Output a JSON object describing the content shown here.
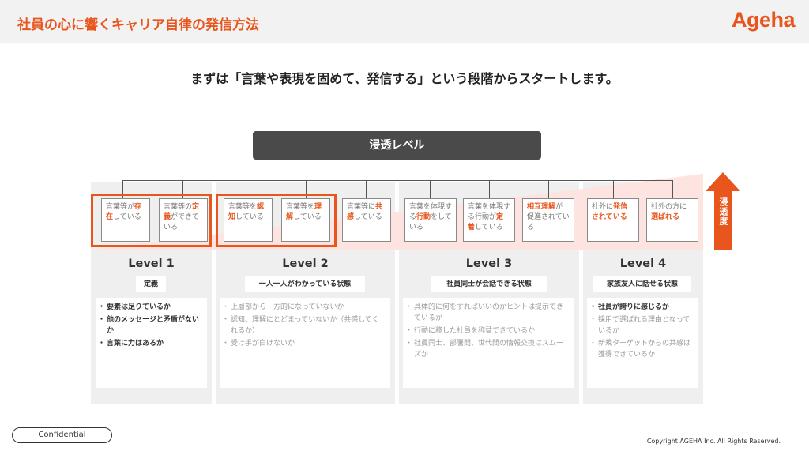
{
  "header": {
    "title": "社員の心に響くキャリア自律の発信方法",
    "logo": "Ageha"
  },
  "headline": "まずは「言葉や表現を固めて、発信する」という段階からスタートします。",
  "root_label": "浸透レベル",
  "arrow_label": "浸透度",
  "colors": {
    "accent": "#e8561e",
    "dark": "#4a4a4a",
    "panel": "#efefef",
    "wedge": "#fde4e0"
  },
  "levels": [
    {
      "label": "Level 1",
      "pill": "定義",
      "cards": [
        {
          "pre": "言葉等が",
          "hl": "存在",
          "post": "している"
        },
        {
          "pre": "言葉等の",
          "hl": "定義",
          "post": "ができている"
        }
      ],
      "questions": [
        "要素は足りているか",
        "他のメッセージと矛盾がないか",
        "言葉に力はあるか"
      ]
    },
    {
      "label": "Level 2",
      "pill": "一人一人がわかっている状態",
      "cards": [
        {
          "pre": "言葉等を",
          "hl": "認知",
          "post": "している"
        },
        {
          "pre": "言葉等を",
          "hl": "理解",
          "post": "している"
        },
        {
          "pre": "言葉等に",
          "hl": "共感",
          "post": "している"
        }
      ],
      "questions": [
        "上層部から一方的になっていないか",
        "認知、理解にとどまっていないか（共感してくれるか）",
        "受け手が白けないか"
      ]
    },
    {
      "label": "Level 3",
      "pill": "社員同士が会話できる状態",
      "cards": [
        {
          "pre": "言葉を体現する",
          "hl": "行動",
          "post": "をしている"
        },
        {
          "pre": "言葉を体現する行動が",
          "hl": "定着",
          "post": "している"
        },
        {
          "pre": "",
          "hl": "相互理解",
          "post": "が促進されている"
        }
      ],
      "questions": [
        "具体的に何をすればいいのかヒントは提示できているか",
        "行動に移した社員を称賛できているか",
        "社員同士、部署間、世代間の情報交換はスムーズか"
      ]
    },
    {
      "label": "Level 4",
      "pill": "家族友人に話せる状態",
      "cards": [
        {
          "pre": "社外に",
          "hl": "発信されている",
          "post": ""
        },
        {
          "pre": "社外の方に",
          "hl": "選ばれる",
          "post": ""
        }
      ],
      "questions": [
        "社員が誇りに感じるか",
        "採用で選ばれる理由となっているか",
        "新規ターゲットからの共感は獲得できているか"
      ]
    }
  ],
  "footer": {
    "confidential": "Confidential",
    "copyright": "Copyright AGEHA Inc. All Rights Reserved."
  }
}
